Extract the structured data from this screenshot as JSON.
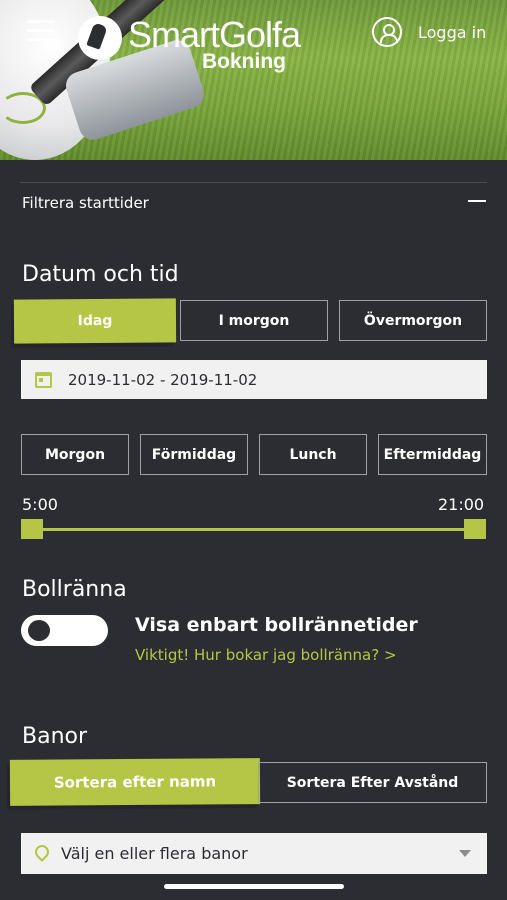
{
  "header": {
    "logo_text": "SmartGolfa",
    "logo_sub": "Bokning",
    "login_label": "Logga in"
  },
  "filter": {
    "title": "Filtrera starttider"
  },
  "date_time": {
    "title": "Datum och tid",
    "day_buttons": [
      "Idag",
      "I morgon",
      "Övermorgon"
    ],
    "active_day": "Idag",
    "date_range": "2019-11-02 - 2019-11-02",
    "time_buttons": [
      "Morgon",
      "Förmiddag",
      "Lunch",
      "Eftermiddag"
    ],
    "slider_min_label": "5:00",
    "slider_max_label": "21:00",
    "slider_range": [
      5,
      21
    ],
    "slider_selected": [
      5,
      21
    ]
  },
  "driving_range": {
    "title": "Bollränna",
    "toggle_label": "Visa enbart bollrännetider",
    "toggle_on": false,
    "help_link": "Viktigt! Hur bokar jag bollränna? >"
  },
  "courses": {
    "title": "Banor",
    "sort_buttons": [
      "Sortera efter namn",
      "Sortera Efter Avstånd"
    ],
    "active_sort": "Sortera efter namn",
    "select_placeholder": "Välj en eller flera banor"
  },
  "colors": {
    "accent": "#b5c647",
    "background": "#2c2d33",
    "field": "#f1f1f1"
  },
  "icons": [
    "menu-icon",
    "user-icon",
    "calendar-icon",
    "location-pin-icon",
    "chevron-down-icon",
    "minus-icon"
  ]
}
